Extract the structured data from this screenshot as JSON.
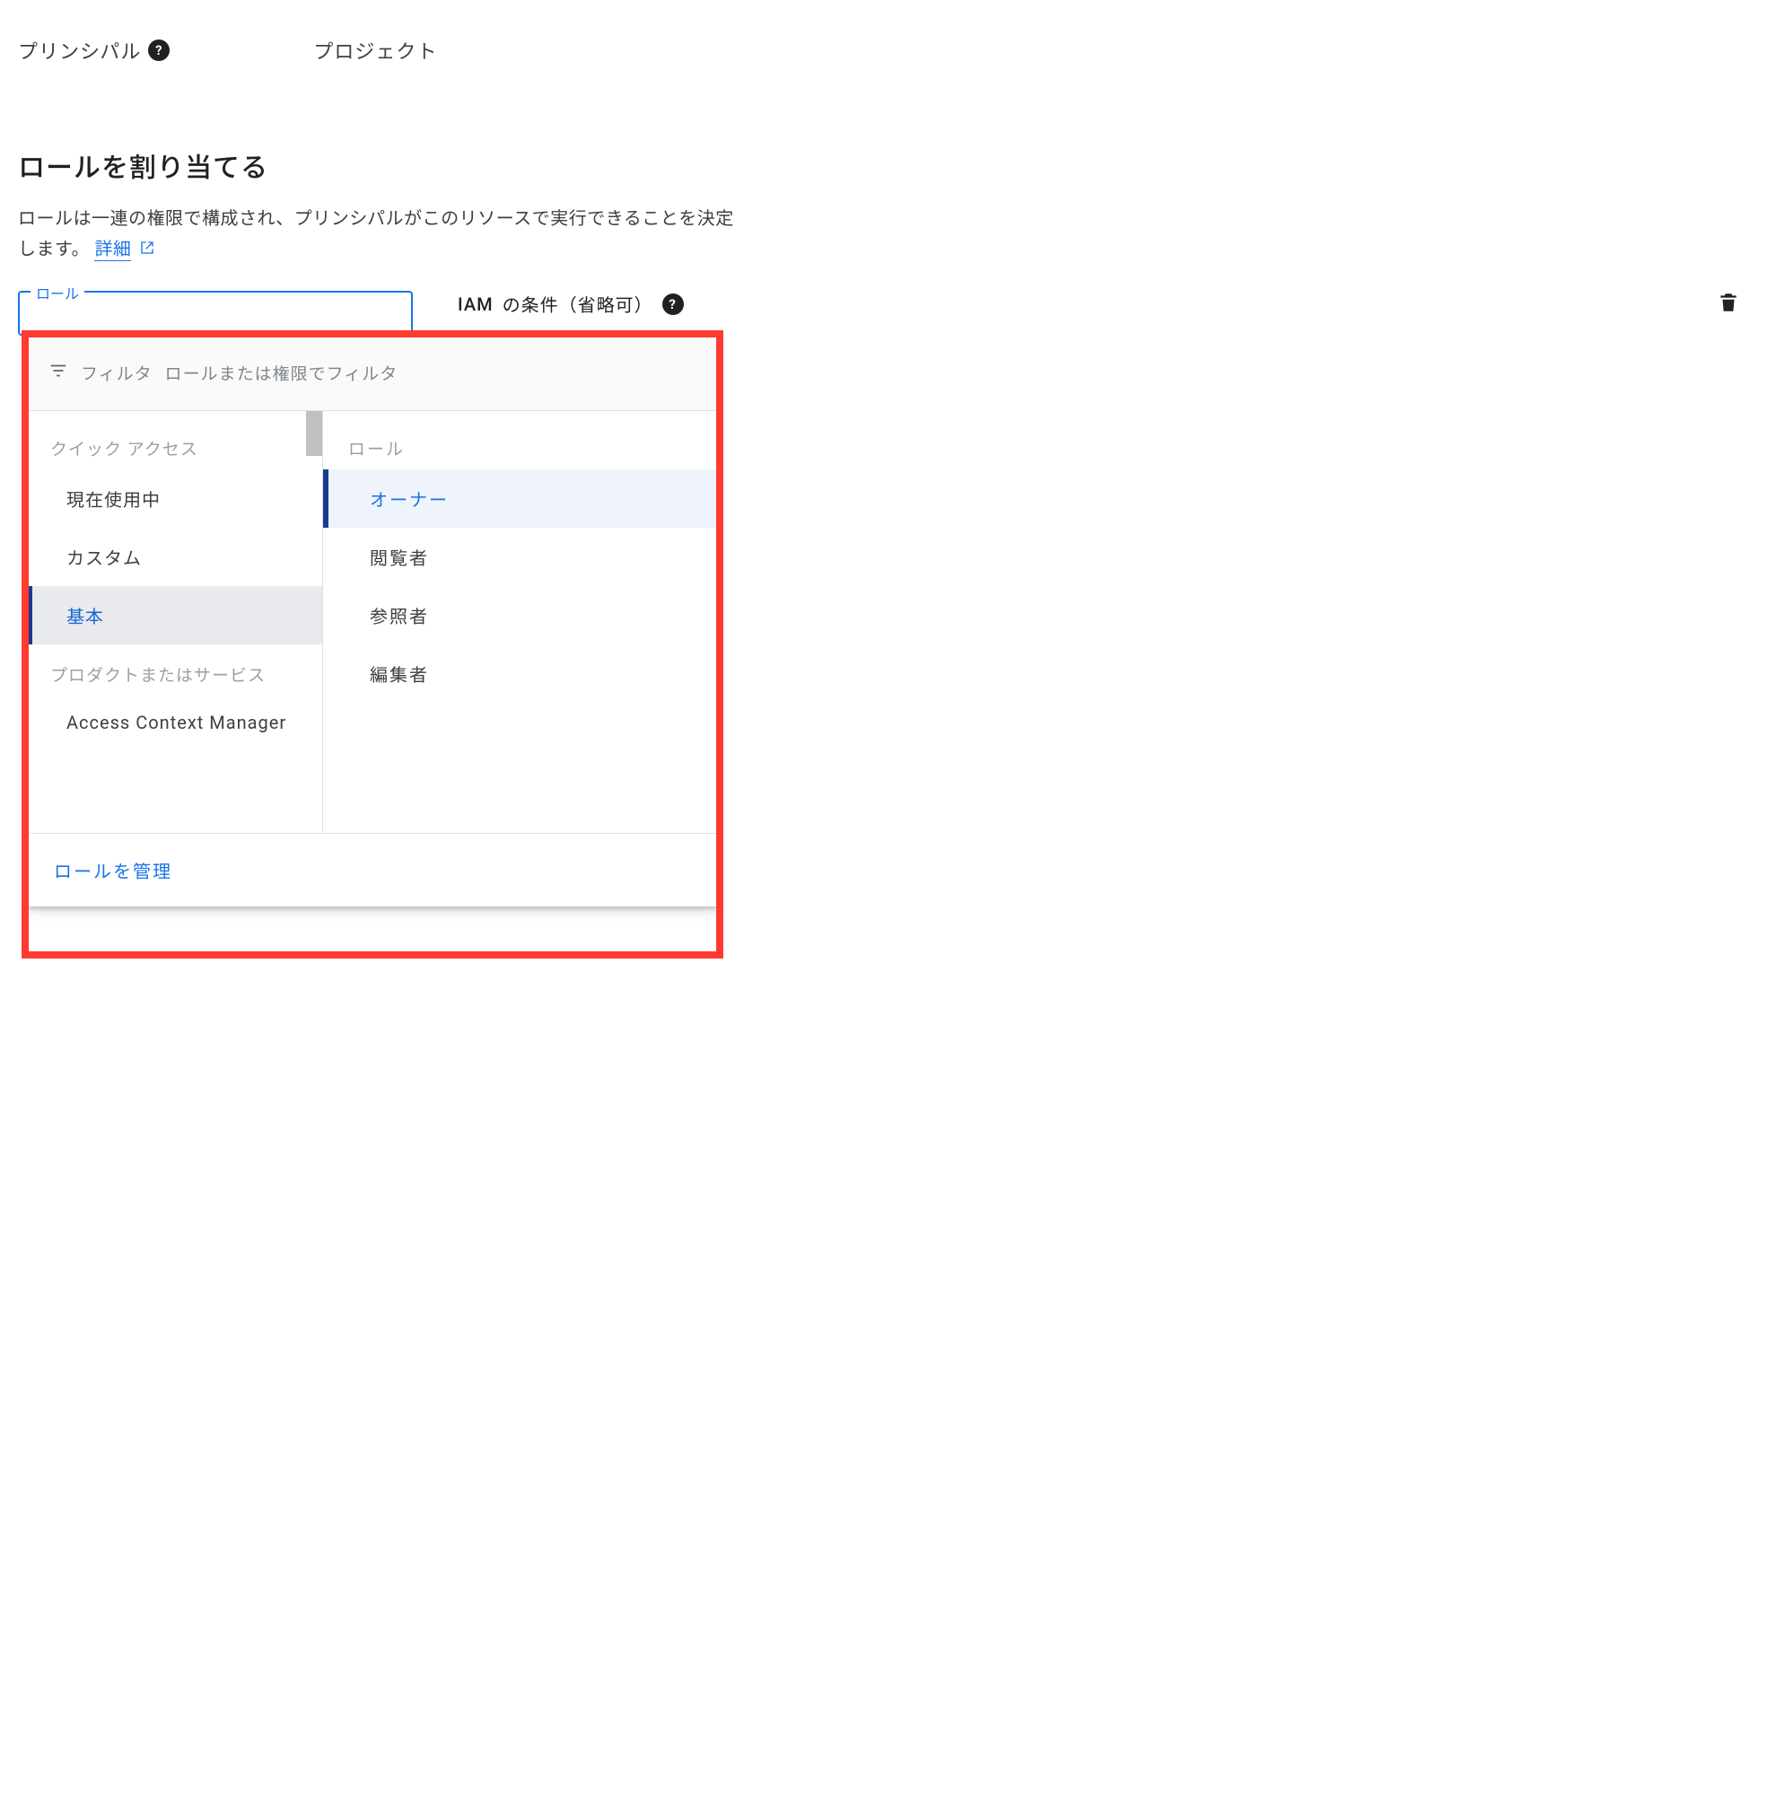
{
  "top": {
    "principal_label": "プリンシパル",
    "project_label": "プロジェクト"
  },
  "section": {
    "title": "ロールを割り当てる",
    "desc_a": "ロールは一連の権限で構成され、プリンシパルがこのリソースで実行できることを決定",
    "desc_b": "します。",
    "learn_more": "詳細"
  },
  "role_field": {
    "label": "ロール"
  },
  "condition": {
    "label_a": "IAM",
    "label_b": "の条件（省略可）"
  },
  "dropdown": {
    "filter_label": "フィルタ",
    "filter_placeholder": "ロールまたは権限でフィルタ",
    "left": {
      "quick_header": "クイック アクセス",
      "items": {
        "in_use": "現在使用中",
        "custom": "カスタム",
        "basic": "基本"
      },
      "product_header": "プロダクトまたはサービス",
      "products": {
        "acm": "Access Context Manager"
      }
    },
    "right": {
      "header": "ロール",
      "roles": {
        "owner": "オーナー",
        "viewer": "閲覧者",
        "browser": "参照者",
        "editor": "編集者"
      }
    },
    "footer": {
      "manage": "ロールを管理"
    }
  }
}
